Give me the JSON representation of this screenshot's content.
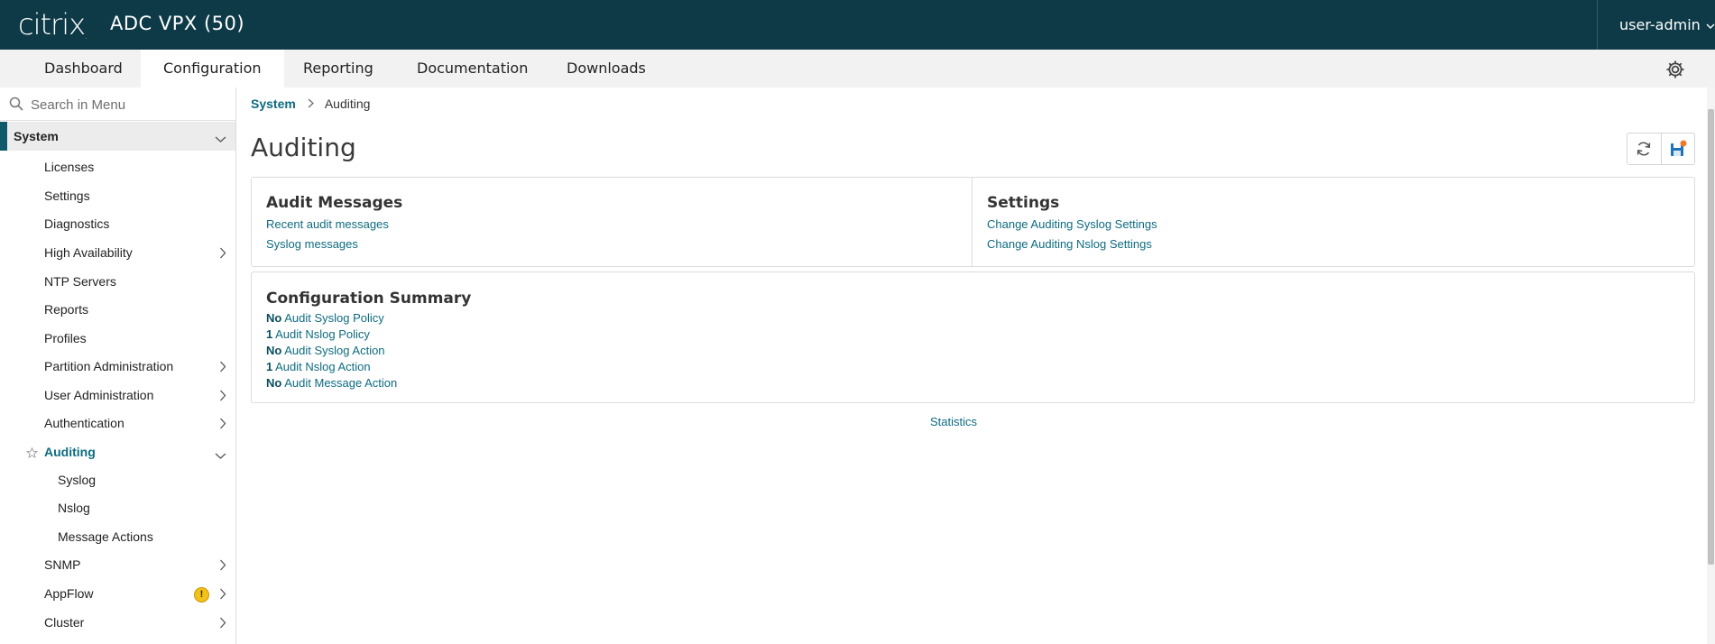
{
  "header": {
    "logo": "citrix",
    "product": "ADC VPX (50)",
    "user": "user-admin"
  },
  "tabs": [
    {
      "label": "Dashboard",
      "active": false
    },
    {
      "label": "Configuration",
      "active": true
    },
    {
      "label": "Reporting",
      "active": false
    },
    {
      "label": "Documentation",
      "active": false
    },
    {
      "label": "Downloads",
      "active": false
    }
  ],
  "sidebar": {
    "search_placeholder": "Search in Menu",
    "section": "System",
    "items": [
      {
        "label": "Licenses",
        "expandable": false
      },
      {
        "label": "Settings",
        "expandable": false
      },
      {
        "label": "Diagnostics",
        "expandable": false
      },
      {
        "label": "High Availability",
        "expandable": true
      },
      {
        "label": "NTP Servers",
        "expandable": false
      },
      {
        "label": "Reports",
        "expandable": false
      },
      {
        "label": "Profiles",
        "expandable": false
      },
      {
        "label": "Partition Administration",
        "expandable": true
      },
      {
        "label": "User Administration",
        "expandable": true
      },
      {
        "label": "Authentication",
        "expandable": true
      },
      {
        "label": "Auditing",
        "expandable": true,
        "expanded": true,
        "active": true
      },
      {
        "label": "Syslog",
        "sub": true
      },
      {
        "label": "Nslog",
        "sub": true
      },
      {
        "label": "Message Actions",
        "sub": true
      },
      {
        "label": "SNMP",
        "expandable": true
      },
      {
        "label": "AppFlow",
        "expandable": true,
        "warning": "!"
      },
      {
        "label": "Cluster",
        "expandable": true
      }
    ]
  },
  "breadcrumb": {
    "parent": "System",
    "current": "Auditing"
  },
  "page": {
    "title": "Auditing"
  },
  "panels": {
    "audit_messages": {
      "title": "Audit Messages",
      "links": [
        "Recent audit messages",
        "Syslog messages"
      ]
    },
    "settings": {
      "title": "Settings",
      "links": [
        "Change Auditing Syslog Settings",
        "Change Auditing Nslog Settings"
      ]
    }
  },
  "summary": {
    "title": "Configuration Summary",
    "lines": [
      {
        "count": "No",
        "label": "Audit Syslog Policy"
      },
      {
        "count": "1",
        "label": "Audit Nslog Policy"
      },
      {
        "count": "No",
        "label": "Audit Syslog Action"
      },
      {
        "count": "1",
        "label": "Audit Nslog Action"
      },
      {
        "count": "No",
        "label": "Audit Message Action"
      }
    ]
  },
  "statistics_link": "Statistics",
  "colors": {
    "header_bg": "#0e3a47",
    "link": "#0e6b80",
    "active_bar": "#0e5a6b",
    "warning": "#f2c21b",
    "save_badge": "#f07a2a"
  }
}
